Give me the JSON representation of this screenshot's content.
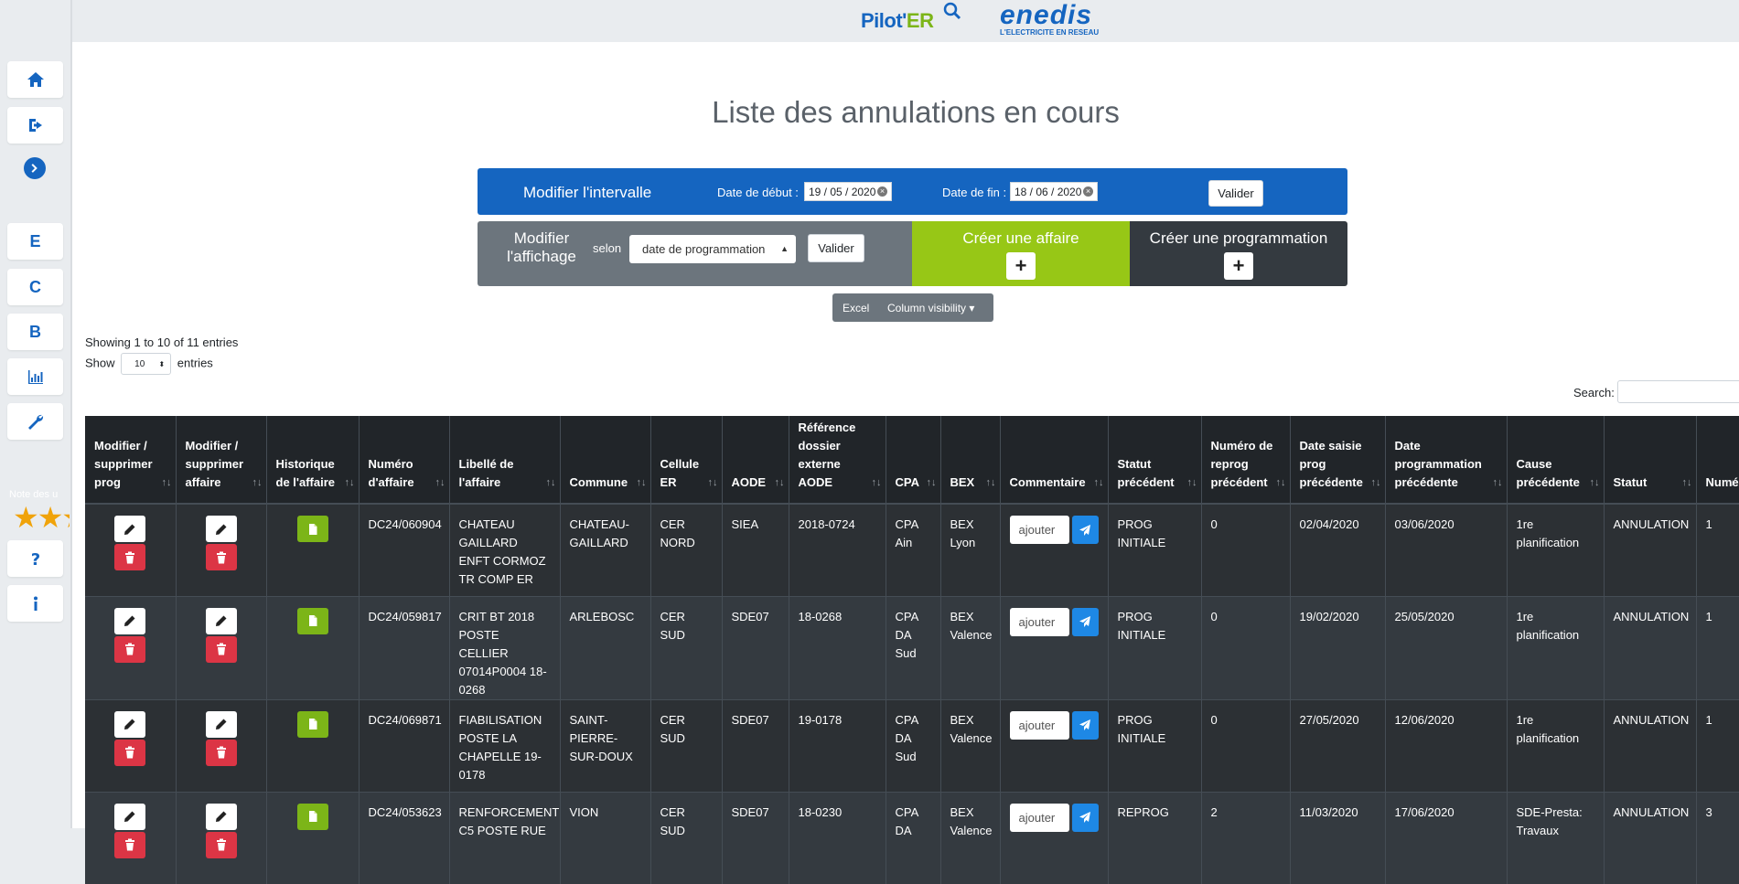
{
  "header": {
    "pilot_logo_main": "Pilot'",
    "pilot_logo_er": "ER",
    "enedis_logo": "enedis",
    "enedis_tagline": "L'ELECTRICITE EN RESEAU"
  },
  "sidebar": {
    "letters": [
      "E",
      "C",
      "B"
    ],
    "rating_label": "Note des u",
    "rating_stars": "★★★"
  },
  "page_title": "Liste des annulations en cours",
  "interval": {
    "title": "Modifier l'intervalle",
    "start_label": "Date de début :",
    "start_value": "19 / 05 / 2020",
    "end_label": "Date de fin :",
    "end_value": "18 / 06 / 2020",
    "validate": "Valider"
  },
  "display": {
    "title": "Modifier l'affichage",
    "selon": "selon",
    "select_value": "date de programmation",
    "validate": "Valider"
  },
  "create_affaire": {
    "title": "Créer une affaire",
    "plus": "+"
  },
  "create_prog": {
    "title": "Créer une programmation",
    "plus": "+"
  },
  "exports": {
    "excel": "Excel",
    "colvis": "Column visibility ▾"
  },
  "table_info": "Showing 1 to 10 of 11 entries",
  "length": {
    "show": "Show",
    "value": "10",
    "entries": "entries"
  },
  "search": {
    "label": "Search:",
    "value": ""
  },
  "columns": [
    "Modifier / supprimer prog",
    "Modifier / supprimer affaire",
    "Historique de l'affaire",
    "Numéro d'affaire",
    "Libellé de l'affaire",
    "Commune",
    "Cellule ER",
    "AODE",
    "Référence dossier externe AODE",
    "CPA",
    "BEX",
    "Commentaire",
    "Statut précédent",
    "Numéro de reprog précédent",
    "Date saisie prog précédente",
    "Date programmation précédente",
    "Cause précédente",
    "Statut",
    "Numé"
  ],
  "comment_placeholder": "ajouter",
  "rows": [
    {
      "num": "DC24/060904",
      "lib": "CHATEAU GAILLARD ENFT CORMOZ TR COMP ER",
      "commune": "CHATEAU-GAILLARD",
      "cellule": "CER NORD",
      "aode": "SIEA",
      "ref": "2018-0724",
      "cpa": "CPA Ain",
      "bex": "BEX Lyon",
      "statut_prec": "PROG INITIALE",
      "num_reprog": "0",
      "date_saisie": "02/04/2020",
      "date_prog": "03/06/2020",
      "cause": "1re planification",
      "statut": "ANNULATION",
      "nume": "1"
    },
    {
      "num": "DC24/059817",
      "lib": "CRIT BT 2018 POSTE CELLIER 07014P0004 18-0268",
      "commune": "ARLEBOSC",
      "cellule": "CER SUD",
      "aode": "SDE07",
      "ref": "18-0268",
      "cpa": "CPA DA Sud",
      "bex": "BEX Valence",
      "statut_prec": "PROG INITIALE",
      "num_reprog": "0",
      "date_saisie": "19/02/2020",
      "date_prog": "25/05/2020",
      "cause": "1re planification",
      "statut": "ANNULATION",
      "nume": "1"
    },
    {
      "num": "DC24/069871",
      "lib": "FIABILISATION POSTE LA CHAPELLE 19-0178",
      "commune": "SAINT-PIERRE-SUR-DOUX",
      "cellule": "CER SUD",
      "aode": "SDE07",
      "ref": "19-0178",
      "cpa": "CPA DA Sud",
      "bex": "BEX Valence",
      "statut_prec": "PROG INITIALE",
      "num_reprog": "0",
      "date_saisie": "27/05/2020",
      "date_prog": "12/06/2020",
      "cause": "1re planification",
      "statut": "ANNULATION",
      "nume": "1"
    },
    {
      "num": "DC24/053623",
      "lib": "RENFORCEMENT C5 POSTE RUE",
      "commune": "VION",
      "cellule": "CER SUD",
      "aode": "SDE07",
      "ref": "18-0230",
      "cpa": "CPA DA",
      "bex": "BEX Valence",
      "statut_prec": "REPROG",
      "num_reprog": "2",
      "date_saisie": "11/03/2020",
      "date_prog": "17/06/2020",
      "cause": "SDE-Presta: Travaux",
      "statut": "ANNULATION",
      "nume": "3"
    }
  ]
}
